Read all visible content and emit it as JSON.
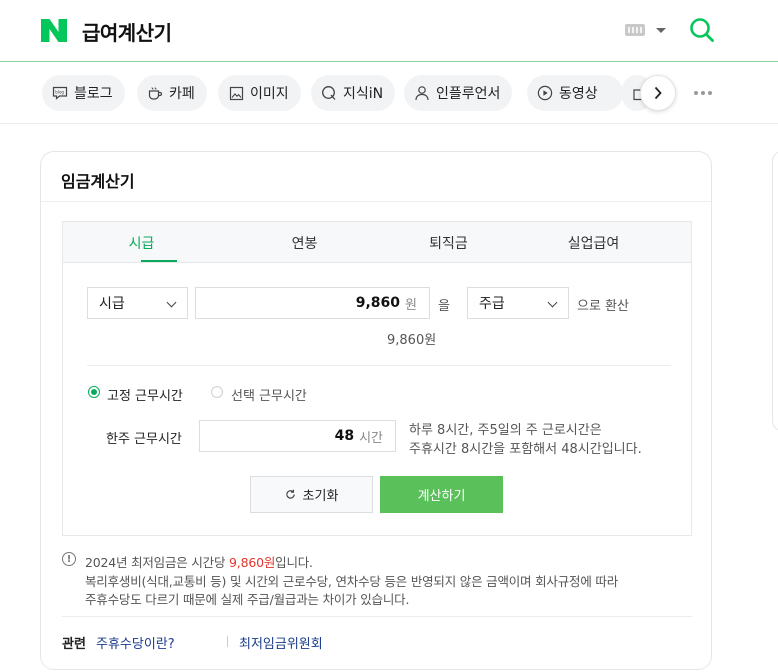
{
  "header": {
    "query": "급여계산기"
  },
  "tabs": [
    {
      "label": "블로그",
      "icon": "blog-icon"
    },
    {
      "label": "카페",
      "icon": "cafe-icon"
    },
    {
      "label": "이미지",
      "icon": "image-icon"
    },
    {
      "label": "지식iN",
      "icon": "kin-icon"
    },
    {
      "label": "인플루언서",
      "icon": "person-icon"
    },
    {
      "label": "동영상",
      "icon": "play-icon"
    }
  ],
  "card": {
    "title": "임금계산기",
    "calc_tabs": [
      "시급",
      "연봉",
      "퇴직금",
      "실업급여"
    ],
    "active_tab": "시급",
    "from_unit": "시급",
    "amount": "9,860",
    "amount_unit": "원",
    "particle": "을",
    "to_unit": "주급",
    "convert_label": "으로 환산",
    "amount_readout": "9,860원",
    "radio_fixed": "고정 근무시간",
    "radio_select": "선택 근무시간",
    "hours_label": "한주 근무시간",
    "hours_value": "48",
    "hours_unit": "시간",
    "hours_hint_1": "하루 8시간, 주5일의 주 근로시간은",
    "hours_hint_2": "주휴시간 8시간을 포함해서 48시간입니다.",
    "reset_label": "초기화",
    "calc_label": "계산하기",
    "note_1_pre": "2024년 최저임금은 시간당 ",
    "note_1_hl": "9,860원",
    "note_1_post": "입니다.",
    "note_2": "복리후생비(식대,교통비 등) 및 시간외 근로수당, 연차수당 등은 반영되지 않은 금액이며 회사규정에 따라",
    "note_3": "주휴수당도 다르기 때문에 실제 주급/월급과는 차이가 있습니다.",
    "related_label": "관련",
    "related_links": [
      "주휴수당이란?",
      "최저임금위원회"
    ]
  },
  "colors": {
    "brand_green": "#03c75a",
    "active_tab": "#09aa5c",
    "calc_button": "#5ac05a",
    "highlight": "#e1372e"
  }
}
